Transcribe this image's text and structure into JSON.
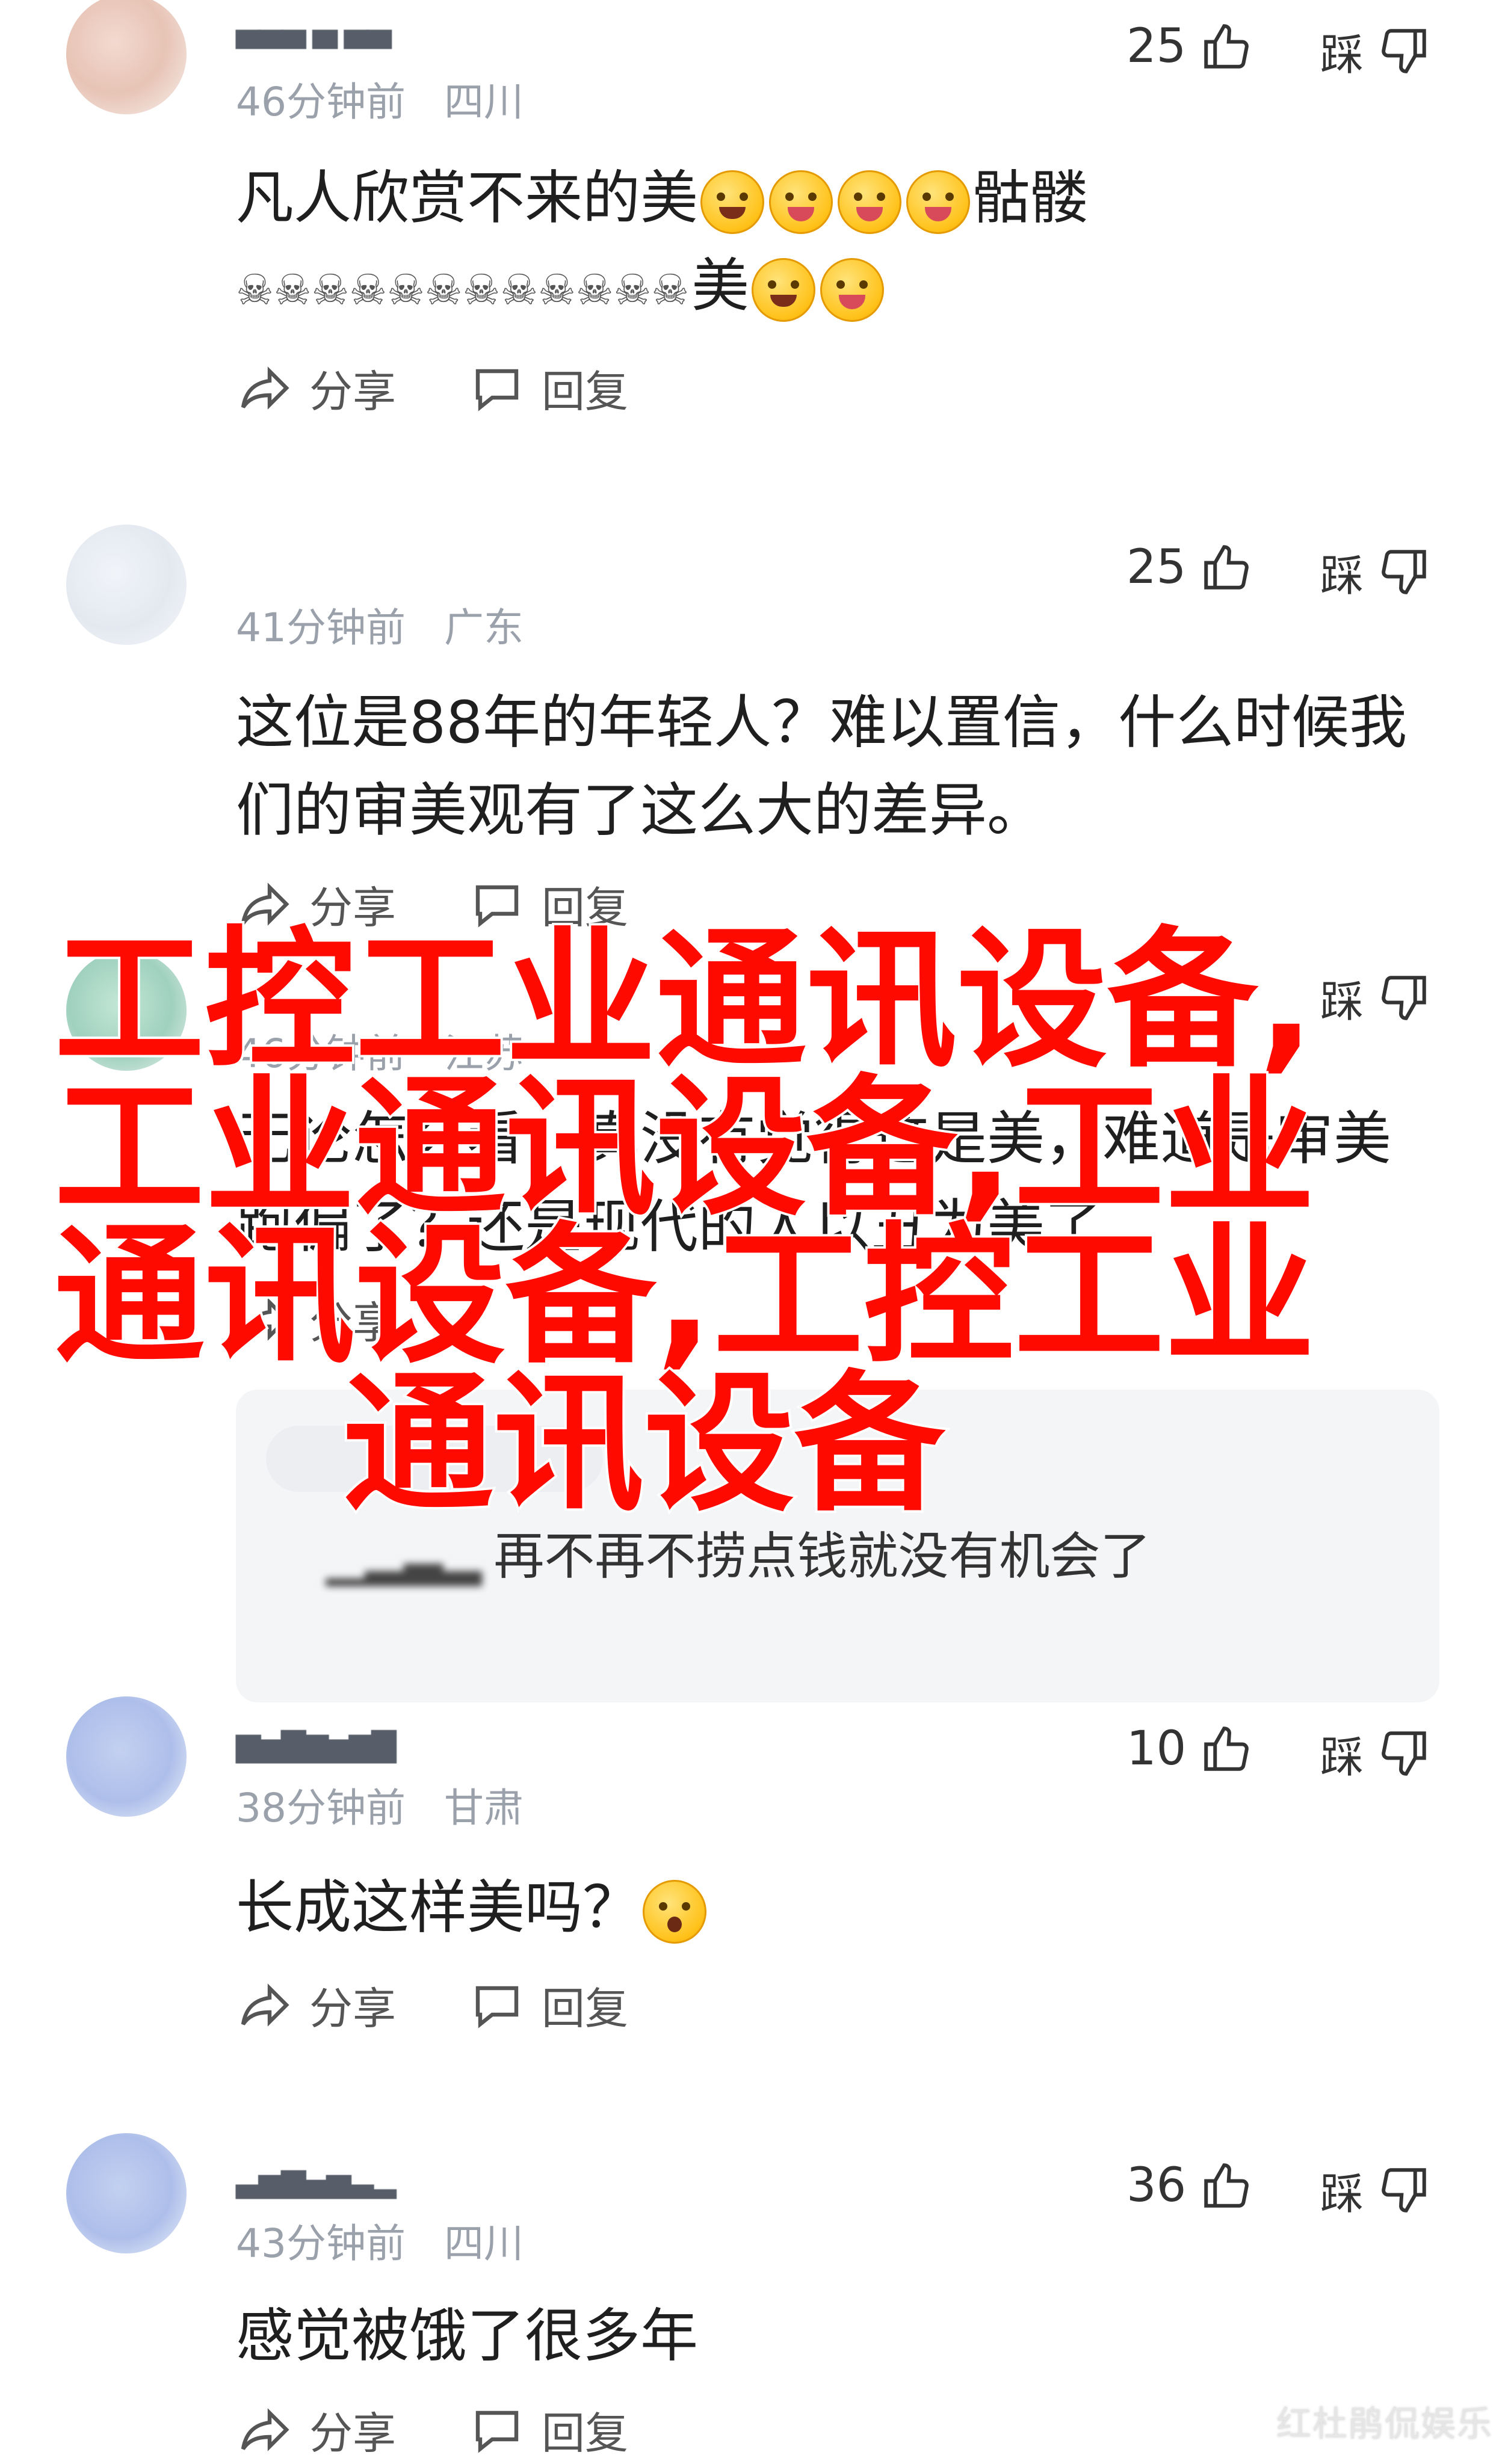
{
  "comments": [
    {
      "likes": "25",
      "dislike_label": "踩",
      "time": "46分钟前",
      "region": "四川",
      "text_line1": "凡人欣赏不来的美",
      "text_line1_tail": "骷髅",
      "text_line2_tail": "美",
      "share_label": "分享",
      "reply_label": "回复"
    },
    {
      "likes": "25",
      "dislike_label": "踩",
      "time": "41分钟前",
      "region": "广东",
      "text_line1": "这位是88年的年轻人？难以置信，什么时候我",
      "text_line2": "们的审美观有了这么大的差异。",
      "share_label": "分享",
      "reply_label": "回复"
    },
    {
      "dislike_label": "踩",
      "time": "46分钟前",
      "region": "江苏",
      "text_line1": "无论怎么看，真没有觉得这是美，难道是审美",
      "text_line2": "跑偏了？还是现代的人以丑为美了",
      "share_label": "分享",
      "reply_snippet_tail": "再不再不捞点钱就没有机会了"
    },
    {
      "likes": "10",
      "dislike_label": "踩",
      "time": "38分钟前",
      "region": "甘肃",
      "text_line1": "长成这样美吗？",
      "share_label": "分享",
      "reply_label": "回复"
    },
    {
      "likes": "36",
      "dislike_label": "踩",
      "time": "43分钟前",
      "region": "四川",
      "text_line1": "感觉被饿了很多年",
      "share_label": "分享",
      "reply_label": "回复"
    }
  ],
  "overlay": {
    "line1": "工控工业通讯设备,",
    "line2": "工业通讯设备,工业",
    "line3": "通讯设备,工控工业",
    "line4": "通讯设备",
    "color": "#ff0a00"
  },
  "watermark": "红杜鹃侃娱乐"
}
